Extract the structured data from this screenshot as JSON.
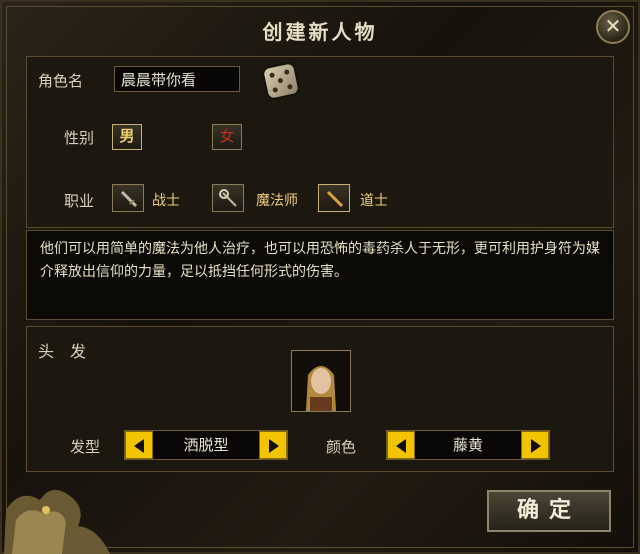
{
  "title": "创建新人物",
  "close_glyph": "✕",
  "name_label": "角色名",
  "name_value": "晨晨带你看",
  "gender_label": "性别",
  "gender_male": "男",
  "gender_female": "女",
  "class_label": "职业",
  "classes": [
    "战士",
    "魔法师",
    "道士"
  ],
  "description": "他们可以用简单的魔法为他人治疗，也可以用恐怖的毒药杀人于无形，更可利用护身符为媒介释放出信仰的力量，足以抵挡任何形式的伤害。",
  "hair_section_label": "头　发",
  "hairstyle_label": "发型",
  "hairstyle_value": "洒脱型",
  "color_label": "颜色",
  "color_value": "藤黄",
  "confirm_label": "确定",
  "colors": {
    "accent_yellow": "#f2c400",
    "text": "#e8e0c4",
    "panel": "#1c1810"
  }
}
